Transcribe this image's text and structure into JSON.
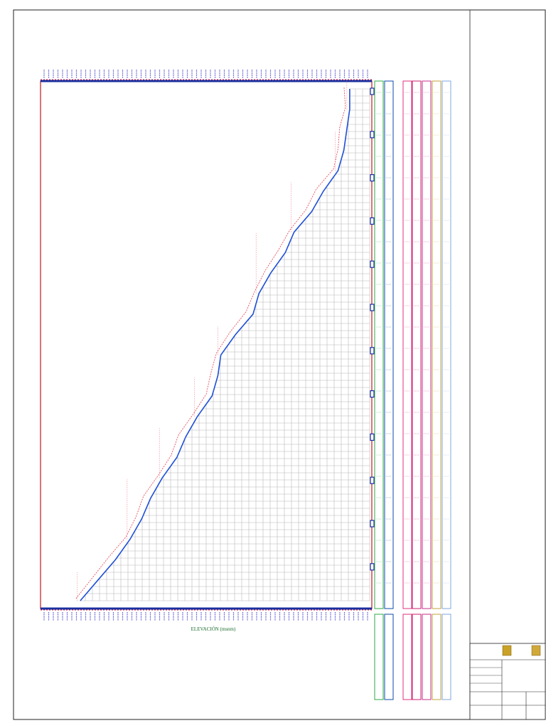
{
  "drawing": {
    "profile_title": "",
    "axis_label": "ELEVACIÓN (msnm)",
    "scale_notes": [
      "",
      ""
    ]
  },
  "bands": [
    {
      "label": "",
      "color": "#2ea84a"
    },
    {
      "label": "",
      "color": "#0d4aa8"
    },
    {
      "label": "",
      "color": "#e0327c"
    },
    {
      "label": "",
      "color": "#cc1f6f"
    },
    {
      "label": "",
      "color": "#c62f8c"
    },
    {
      "label": "",
      "color": "#c4a33a"
    },
    {
      "label": "",
      "color": "#7fa6e0"
    }
  ],
  "title_block": {
    "institution": "",
    "project": "",
    "sheet_title": "",
    "rows": [
      {
        "label": "",
        "value": ""
      },
      {
        "label": "",
        "value": ""
      },
      {
        "label": "",
        "value": ""
      },
      {
        "label": "",
        "value": ""
      }
    ],
    "bottom_fields": [
      "",
      "",
      ""
    ]
  },
  "chart_data": {
    "type": "line",
    "title": "",
    "xlabel": "",
    "ylabel": "ELEVACIÓN (msnm)",
    "orientation": "rotated",
    "x_range": [
      0,
      100
    ],
    "y_range": [
      0,
      100
    ],
    "grid": true,
    "series": [
      {
        "color": "#1f4fd6",
        "points": [
          [
            0,
            7
          ],
          [
            4,
            13
          ],
          [
            8,
            19
          ],
          [
            12,
            24
          ],
          [
            16,
            28
          ],
          [
            20,
            31
          ],
          [
            24,
            35
          ],
          [
            28,
            40
          ],
          [
            32,
            43
          ],
          [
            36,
            47
          ],
          [
            40,
            52
          ],
          [
            44,
            54
          ],
          [
            48,
            55
          ],
          [
            52,
            60
          ],
          [
            56,
            66
          ],
          [
            60,
            68
          ],
          [
            64,
            72
          ],
          [
            68,
            77
          ],
          [
            72,
            80
          ],
          [
            76,
            86
          ],
          [
            80,
            90
          ],
          [
            84,
            95
          ],
          [
            88,
            97
          ],
          [
            92,
            98
          ],
          [
            96,
            99
          ],
          [
            100,
            99
          ]
        ]
      }
    ]
  }
}
